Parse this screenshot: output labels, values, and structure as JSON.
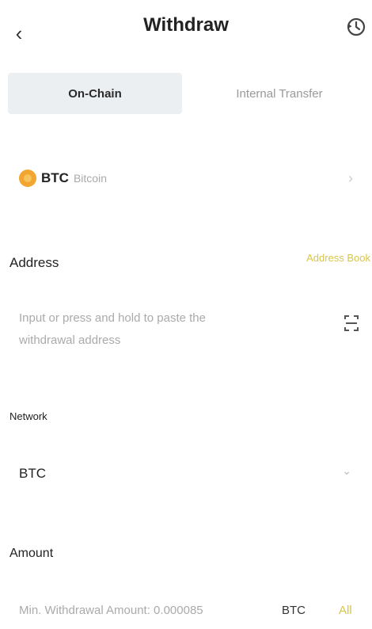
{
  "header": {
    "title": "Withdraw",
    "back_glyph": "‹",
    "history_icon": "history-icon"
  },
  "tabs": [
    {
      "label": "On-Chain",
      "active": true
    },
    {
      "label": "Internal Transfer",
      "active": false
    }
  ],
  "coin": {
    "symbol": "BTC",
    "name": "Bitcoin",
    "icon_color": "#f2a52f",
    "chevron": "›"
  },
  "address": {
    "label": "Address",
    "address_book": "Address Book",
    "placeholder_line1": "Input or press and hold to paste the",
    "placeholder_line2": "withdrawal address"
  },
  "network": {
    "label": "Network",
    "value": "BTC",
    "chevron": "⌄"
  },
  "amount": {
    "label": "Amount",
    "placeholder": "Min. Withdrawal Amount: 0.000085",
    "unit": "BTC",
    "all_label": "All"
  },
  "colors": {
    "accent": "#d8c64a",
    "tab_active_bg": "#eceff2"
  }
}
